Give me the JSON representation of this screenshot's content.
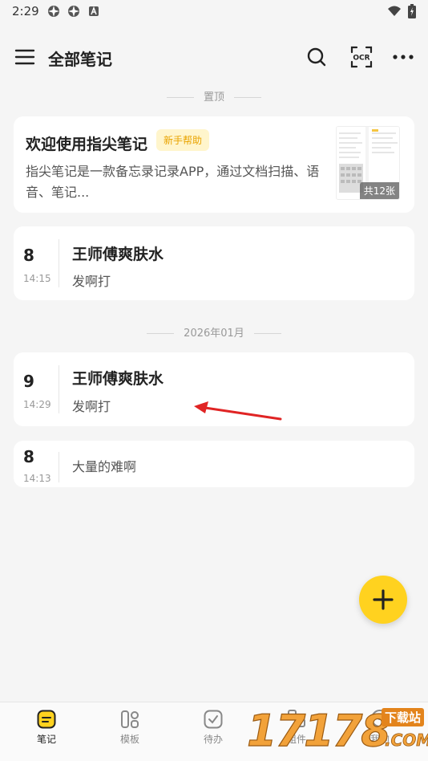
{
  "status_bar": {
    "time": "2:29",
    "icons": [
      "app-icon",
      "app-icon",
      "a-icon",
      "wifi-icon",
      "battery-icon"
    ]
  },
  "app_bar": {
    "title": "全部笔记",
    "menu_icon": "hamburger-icon",
    "actions": [
      "search-icon",
      "ocr-icon",
      "more-icon"
    ],
    "ocr_label": "OCR"
  },
  "sections": {
    "pinned_label": "置顶",
    "month_label": "2026年01月"
  },
  "pinned_card": {
    "title": "欢迎使用指尖笔记",
    "badge": "新手帮助",
    "description": "指尖笔记是一款备忘录记录APP，通过文档扫描、语音、笔记...",
    "image_count": "共12张",
    "badge_color": "#e9a400"
  },
  "notes_pinned": [
    {
      "day": "8",
      "time": "14:15",
      "title": "王师傅爽肤水",
      "body": "发啊打"
    }
  ],
  "notes_month": [
    {
      "day": "9",
      "time": "14:29",
      "title": "王师傅爽肤水",
      "body": "发啊打"
    },
    {
      "day": "8",
      "time": "14:13",
      "title": "",
      "body": "大量的难啊"
    }
  ],
  "fab": {
    "icon": "plus-icon",
    "color": "#ffd21f"
  },
  "bottom_nav": {
    "items": [
      {
        "label": "笔记",
        "icon": "note-icon",
        "active": true
      },
      {
        "label": "模板",
        "icon": "template-icon",
        "active": false
      },
      {
        "label": "待办",
        "icon": "checkbox-icon",
        "active": false
      },
      {
        "label": "组件",
        "icon": "widget-icon",
        "active": false
      },
      {
        "label": "我的",
        "icon": "profile-icon",
        "active": false
      }
    ]
  },
  "watermark": {
    "digits": "17178",
    "text_cn": "下载站",
    "text_com": ".COM"
  },
  "colors": {
    "accent": "#ffd21f",
    "background": "#f5f5f5",
    "annotation_arrow": "#e02424"
  }
}
